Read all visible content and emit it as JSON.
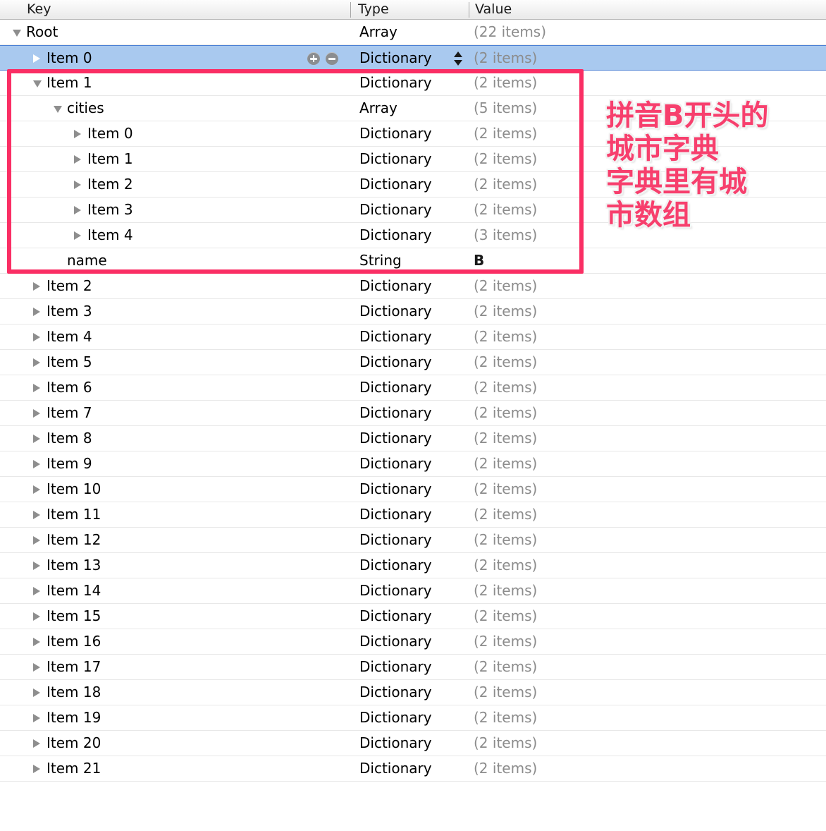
{
  "header": {
    "columns": [
      {
        "label": "Key",
        "name": "column-header-key"
      },
      {
        "label": "Type",
        "name": "column-header-type"
      },
      {
        "label": "Value",
        "name": "column-header-value"
      }
    ]
  },
  "colors": {
    "selection_fill": "#a9c9ef",
    "selection_border": "#4a7fd4",
    "annotation_pink": "#fa2e64",
    "annotation_text_pink": "#f73f6d",
    "value_gray": "#8c8c8c",
    "triangle_gray": "#8e8e8e"
  },
  "rows": [
    {
      "key": "Root",
      "type": "Array",
      "value": "(22 items)",
      "indent": 0,
      "disclosure": "expanded",
      "selected": false,
      "literal": false
    },
    {
      "key": "Item 0",
      "type": "Dictionary",
      "value": "(2 items)",
      "indent": 1,
      "disclosure": "collapsed",
      "selected": true,
      "literal": false
    },
    {
      "key": "Item 1",
      "type": "Dictionary",
      "value": "(2 items)",
      "indent": 1,
      "disclosure": "expanded",
      "selected": false,
      "literal": false
    },
    {
      "key": "cities",
      "type": "Array",
      "value": "(5 items)",
      "indent": 2,
      "disclosure": "expanded",
      "selected": false,
      "literal": false
    },
    {
      "key": "Item 0",
      "type": "Dictionary",
      "value": "(2 items)",
      "indent": 3,
      "disclosure": "collapsed",
      "selected": false,
      "literal": false
    },
    {
      "key": "Item 1",
      "type": "Dictionary",
      "value": "(2 items)",
      "indent": 3,
      "disclosure": "collapsed",
      "selected": false,
      "literal": false
    },
    {
      "key": "Item 2",
      "type": "Dictionary",
      "value": "(2 items)",
      "indent": 3,
      "disclosure": "collapsed",
      "selected": false,
      "literal": false
    },
    {
      "key": "Item 3",
      "type": "Dictionary",
      "value": "(2 items)",
      "indent": 3,
      "disclosure": "collapsed",
      "selected": false,
      "literal": false
    },
    {
      "key": "Item 4",
      "type": "Dictionary",
      "value": "(3 items)",
      "indent": 3,
      "disclosure": "collapsed",
      "selected": false,
      "literal": false
    },
    {
      "key": "name",
      "type": "String",
      "value": "B",
      "indent": 2,
      "disclosure": "none",
      "selected": false,
      "literal": true
    },
    {
      "key": "Item 2",
      "type": "Dictionary",
      "value": "(2 items)",
      "indent": 1,
      "disclosure": "collapsed",
      "selected": false,
      "literal": false
    },
    {
      "key": "Item 3",
      "type": "Dictionary",
      "value": "(2 items)",
      "indent": 1,
      "disclosure": "collapsed",
      "selected": false,
      "literal": false
    },
    {
      "key": "Item 4",
      "type": "Dictionary",
      "value": "(2 items)",
      "indent": 1,
      "disclosure": "collapsed",
      "selected": false,
      "literal": false
    },
    {
      "key": "Item 5",
      "type": "Dictionary",
      "value": "(2 items)",
      "indent": 1,
      "disclosure": "collapsed",
      "selected": false,
      "literal": false
    },
    {
      "key": "Item 6",
      "type": "Dictionary",
      "value": "(2 items)",
      "indent": 1,
      "disclosure": "collapsed",
      "selected": false,
      "literal": false
    },
    {
      "key": "Item 7",
      "type": "Dictionary",
      "value": "(2 items)",
      "indent": 1,
      "disclosure": "collapsed",
      "selected": false,
      "literal": false
    },
    {
      "key": "Item 8",
      "type": "Dictionary",
      "value": "(2 items)",
      "indent": 1,
      "disclosure": "collapsed",
      "selected": false,
      "literal": false
    },
    {
      "key": "Item 9",
      "type": "Dictionary",
      "value": "(2 items)",
      "indent": 1,
      "disclosure": "collapsed",
      "selected": false,
      "literal": false
    },
    {
      "key": "Item 10",
      "type": "Dictionary",
      "value": "(2 items)",
      "indent": 1,
      "disclosure": "collapsed",
      "selected": false,
      "literal": false
    },
    {
      "key": "Item 11",
      "type": "Dictionary",
      "value": "(2 items)",
      "indent": 1,
      "disclosure": "collapsed",
      "selected": false,
      "literal": false
    },
    {
      "key": "Item 12",
      "type": "Dictionary",
      "value": "(2 items)",
      "indent": 1,
      "disclosure": "collapsed",
      "selected": false,
      "literal": false
    },
    {
      "key": "Item 13",
      "type": "Dictionary",
      "value": "(2 items)",
      "indent": 1,
      "disclosure": "collapsed",
      "selected": false,
      "literal": false
    },
    {
      "key": "Item 14",
      "type": "Dictionary",
      "value": "(2 items)",
      "indent": 1,
      "disclosure": "collapsed",
      "selected": false,
      "literal": false
    },
    {
      "key": "Item 15",
      "type": "Dictionary",
      "value": "(2 items)",
      "indent": 1,
      "disclosure": "collapsed",
      "selected": false,
      "literal": false
    },
    {
      "key": "Item 16",
      "type": "Dictionary",
      "value": "(2 items)",
      "indent": 1,
      "disclosure": "collapsed",
      "selected": false,
      "literal": false
    },
    {
      "key": "Item 17",
      "type": "Dictionary",
      "value": "(2 items)",
      "indent": 1,
      "disclosure": "collapsed",
      "selected": false,
      "literal": false
    },
    {
      "key": "Item 18",
      "type": "Dictionary",
      "value": "(2 items)",
      "indent": 1,
      "disclosure": "collapsed",
      "selected": false,
      "literal": false
    },
    {
      "key": "Item 19",
      "type": "Dictionary",
      "value": "(2 items)",
      "indent": 1,
      "disclosure": "collapsed",
      "selected": false,
      "literal": false
    },
    {
      "key": "Item 20",
      "type": "Dictionary",
      "value": "(2 items)",
      "indent": 1,
      "disclosure": "collapsed",
      "selected": false,
      "literal": false
    },
    {
      "key": "Item 21",
      "type": "Dictionary",
      "value": "(2 items)",
      "indent": 1,
      "disclosure": "collapsed",
      "selected": false,
      "literal": false
    }
  ],
  "selected_row_controls": {
    "add_button_label": "+",
    "remove_button_label": "−",
    "stepper_up_label": "▲",
    "stepper_down_label": "▼"
  },
  "annotation": {
    "lines": [
      "拼音B开头的",
      "城市字典",
      "字典里有城",
      "市数组"
    ]
  }
}
